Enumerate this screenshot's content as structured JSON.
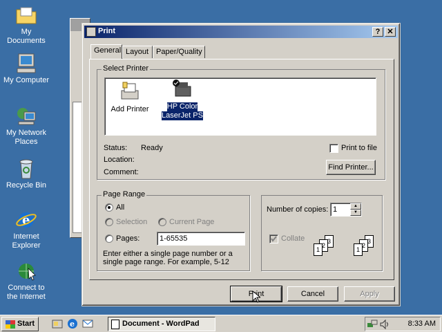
{
  "desktop": {
    "icons": [
      {
        "label": "My Documents"
      },
      {
        "label": "My Computer"
      },
      {
        "label_line1": "My Network",
        "label_line2": "Places"
      },
      {
        "label": "Recycle Bin"
      },
      {
        "label_line1": "Internet",
        "label_line2": "Explorer"
      },
      {
        "label_line1": "Connect to",
        "label_line2": "the Internet"
      }
    ]
  },
  "dialog": {
    "title": "Print",
    "help_button": "?",
    "close_button": "✕",
    "tabs": [
      "General",
      "Layout",
      "Paper/Quality"
    ],
    "select_printer": {
      "legend": "Select Printer",
      "printers": [
        {
          "label": "Add Printer"
        },
        {
          "label_line1": "HP Color",
          "label_line2": "LaserJet PS",
          "selected": true
        }
      ],
      "status_label": "Status:",
      "status_value": "Ready",
      "location_label": "Location:",
      "comment_label": "Comment:",
      "print_to_file": "Print to file",
      "find_printer": "Find Printer..."
    },
    "page_range": {
      "legend": "Page Range",
      "all": "All",
      "selection": "Selection",
      "current_page": "Current Page",
      "pages": "Pages:",
      "pages_value": "1-65535",
      "hint": "Enter either a single page number or a single page range.  For example, 5-12"
    },
    "copies": {
      "label": "Number of copies:",
      "value": "1",
      "collate": "Collate"
    },
    "buttons": {
      "print": "Print",
      "cancel": "Cancel",
      "apply": "Apply"
    }
  },
  "taskbar": {
    "start": "Start",
    "task": "Document - WordPad",
    "clock": "8:33 AM"
  }
}
